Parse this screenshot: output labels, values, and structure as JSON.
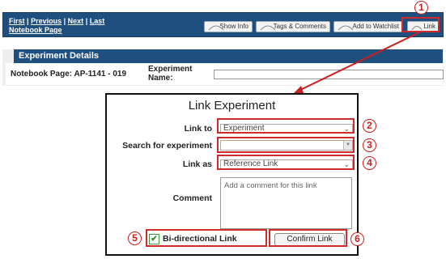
{
  "notebook_nav": {
    "first": "First",
    "previous": "Previous",
    "next": "Next",
    "last_notebook_page": "Last Notebook Page",
    "separator": "|"
  },
  "toolbar": {
    "show_info": "Show Info",
    "tags_comments": "Tags & Comments",
    "add_watchlist": "Add to Watchlist",
    "link": "Link"
  },
  "experiment_details": {
    "header": "Experiment Details",
    "notebook_page": "Notebook Page: AP-1141 - 019",
    "experiment_name_label": "Experiment Name:",
    "experiment_name_value": ""
  },
  "dialog": {
    "title": "Link Experiment",
    "link_to_label": "Link to",
    "link_to_value": "Experiment",
    "search_label": "Search for experiment",
    "search_value": "",
    "link_as_label": "Link as",
    "link_as_value": "Reference Link",
    "comment_label": "Comment",
    "comment_placeholder": "Add a comment for this link",
    "bidirectional_label": "Bi-directional Link",
    "bidirectional_checked": true,
    "confirm_label": "Confirm Link"
  },
  "callouts": [
    "1",
    "2",
    "3",
    "4",
    "5",
    "6"
  ],
  "colors": {
    "header_blue": "#1f4f7e",
    "callout_red": "#d12a2a",
    "check_green": "#2e8b2e"
  },
  "icons": {
    "chevron": "chevron-down-icon",
    "check": "checkmark-icon"
  }
}
